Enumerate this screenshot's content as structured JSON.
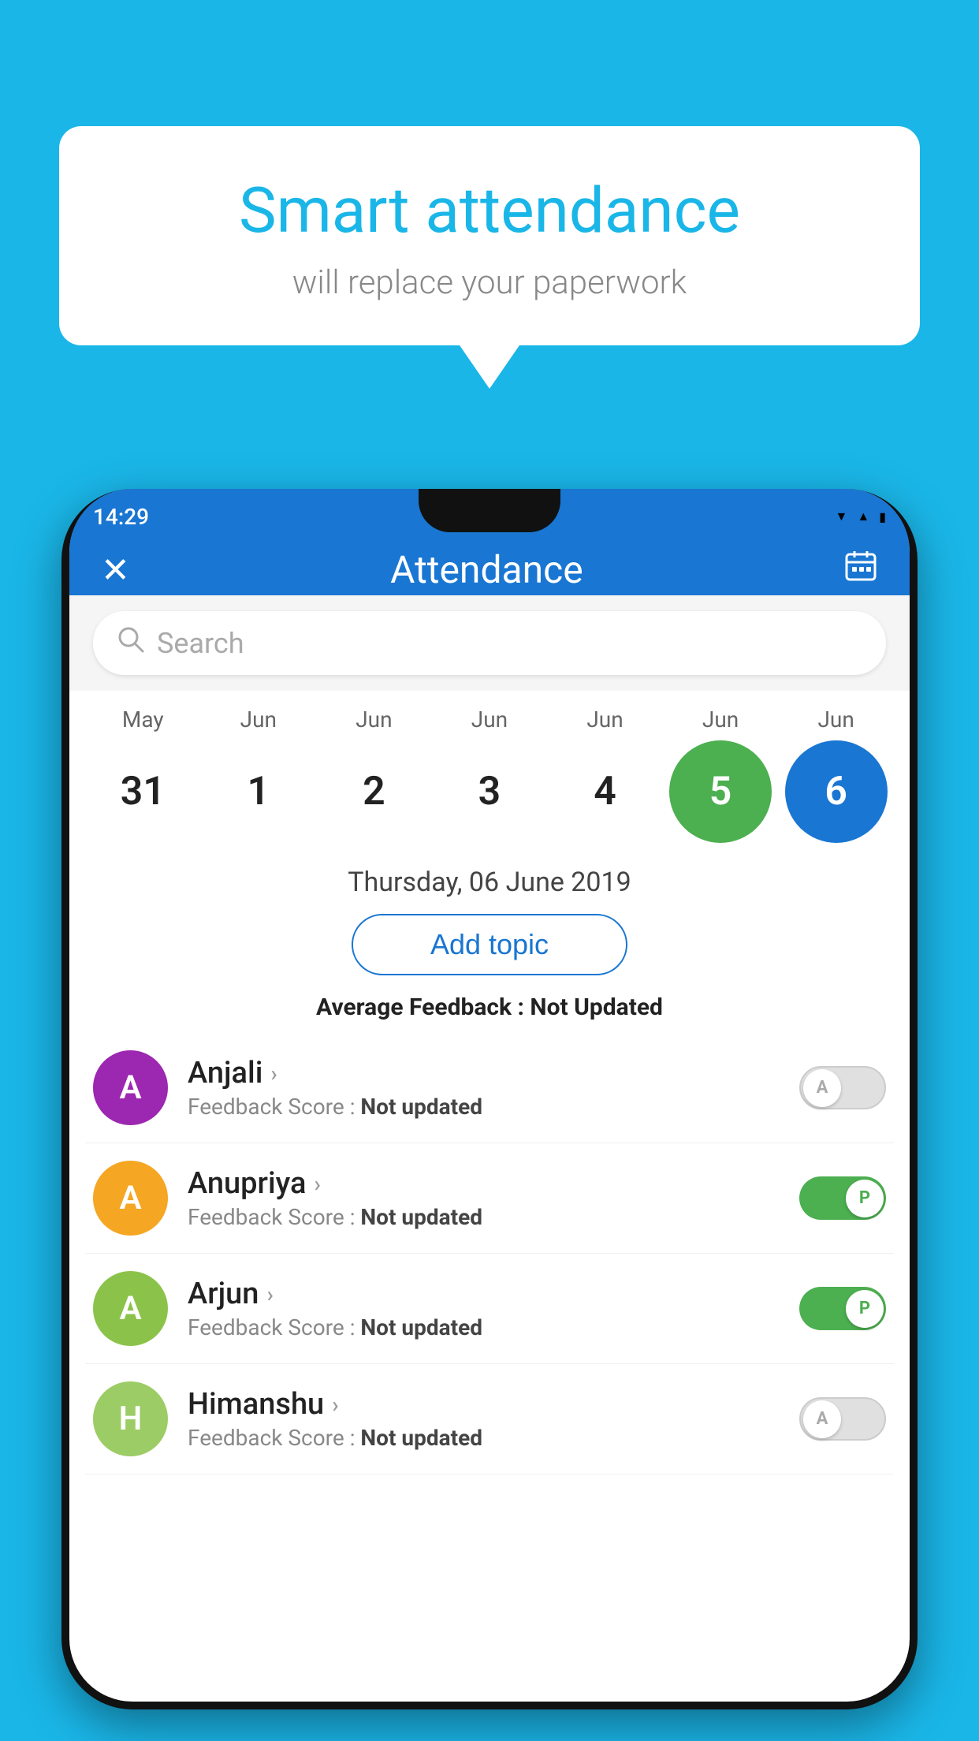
{
  "background_color": "#1ab6e8",
  "speech_bubble": {
    "title": "Smart attendance",
    "subtitle": "will replace your paperwork"
  },
  "status_bar": {
    "time": "14:29",
    "wifi_icon": "▼",
    "signal_icon": "▲",
    "battery_icon": "▮"
  },
  "top_bar": {
    "title": "Attendance",
    "close_label": "✕",
    "calendar_icon": "📅"
  },
  "search": {
    "placeholder": "Search"
  },
  "calendar": {
    "months": [
      "May",
      "Jun",
      "Jun",
      "Jun",
      "Jun",
      "Jun",
      "Jun"
    ],
    "dates": [
      "31",
      "1",
      "2",
      "3",
      "4",
      "5",
      "6"
    ],
    "states": [
      "normal",
      "normal",
      "normal",
      "normal",
      "normal",
      "today",
      "selected"
    ]
  },
  "selected_date_label": "Thursday, 06 June 2019",
  "add_topic_label": "Add topic",
  "average_feedback": {
    "label": "Average Feedback : ",
    "value": "Not Updated"
  },
  "students": [
    {
      "name": "Anjali",
      "avatar_letter": "A",
      "avatar_color": "#9c27b0",
      "feedback_label": "Feedback Score : ",
      "feedback_value": "Not updated",
      "toggle_state": "off",
      "toggle_label": "A"
    },
    {
      "name": "Anupriya",
      "avatar_letter": "A",
      "avatar_color": "#f5a623",
      "feedback_label": "Feedback Score : ",
      "feedback_value": "Not updated",
      "toggle_state": "on",
      "toggle_label": "P"
    },
    {
      "name": "Arjun",
      "avatar_letter": "A",
      "avatar_color": "#8bc34a",
      "feedback_label": "Feedback Score : ",
      "feedback_value": "Not updated",
      "toggle_state": "on",
      "toggle_label": "P"
    },
    {
      "name": "Himanshu",
      "avatar_letter": "H",
      "avatar_color": "#9ccc65",
      "feedback_label": "Feedback Score : ",
      "feedback_value": "Not updated",
      "toggle_state": "off",
      "toggle_label": "A"
    }
  ]
}
